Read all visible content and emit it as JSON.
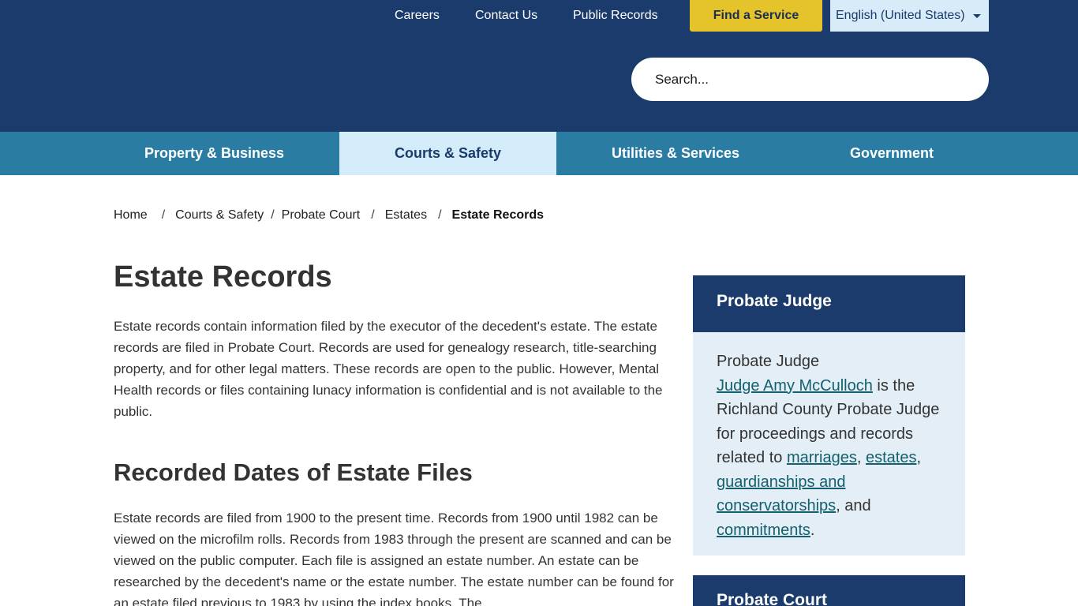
{
  "utility_nav": {
    "careers": "Careers",
    "contact_us": "Contact Us",
    "public_records": "Public Records",
    "find_service": "Find a Service",
    "language": "English (United States)"
  },
  "search": {
    "placeholder": "Search..."
  },
  "main_nav": {
    "items": [
      {
        "label": "Property & Business"
      },
      {
        "label": "Courts & Safety",
        "active": true
      },
      {
        "label": "Utilities & Services"
      },
      {
        "label": "Government"
      }
    ]
  },
  "breadcrumb": {
    "items": [
      "Home",
      "Courts & Safety",
      "Probate Court",
      "Estates"
    ],
    "current": "Estate Records",
    "separator": "/"
  },
  "page": {
    "title": "Estate Records",
    "intro": "Estate records contain information filed by the executor of the decedent's estate. The estate records are filed in Probate Court. Records are used for genealogy research, title-searching property, and for other legal matters. These records are open to the public. However, Mental Health records or files containing lunacy information is confidential and is not available to the public.",
    "section_heading": "Recorded Dates of Estate Files",
    "section_body": "Estate records are filed from 1900 to the present time. Records from 1900 until 1982 can be viewed on the microfilm rolls. Records from 1983 through the present are scanned and can be viewed on the public computer. Each file is assigned an estate number. An estate can be researched by the decedent's name or the estate number. The estate number can be found for an estate filed previous to 1983 by using the index books. The"
  },
  "sidebar": {
    "card1": {
      "title": "Probate Judge",
      "text_lead": "Probate Judge",
      "judge_link": "Judge Amy McCulloch",
      "text_mid": " is the Richland County Probate Judge for proceedings and records related to ",
      "link_marriages": "marriages",
      "comma1": ",",
      "link_estates": "estates",
      "comma2": ", ",
      "link_guardianships": "guardianships and conservatorships",
      "and_text": ", and",
      "link_commitments": "commitments",
      "period": "."
    },
    "card2": {
      "title": "Probate Court"
    }
  },
  "colors": {
    "header_bg": "#1a3b6b",
    "nav_bg": "#2a7ca3",
    "nav_active_bg": "#d4ecf9",
    "find_service_bg": "#e5c32b",
    "sidebar_body_bg": "#e3eef6",
    "link": "#13606e"
  }
}
